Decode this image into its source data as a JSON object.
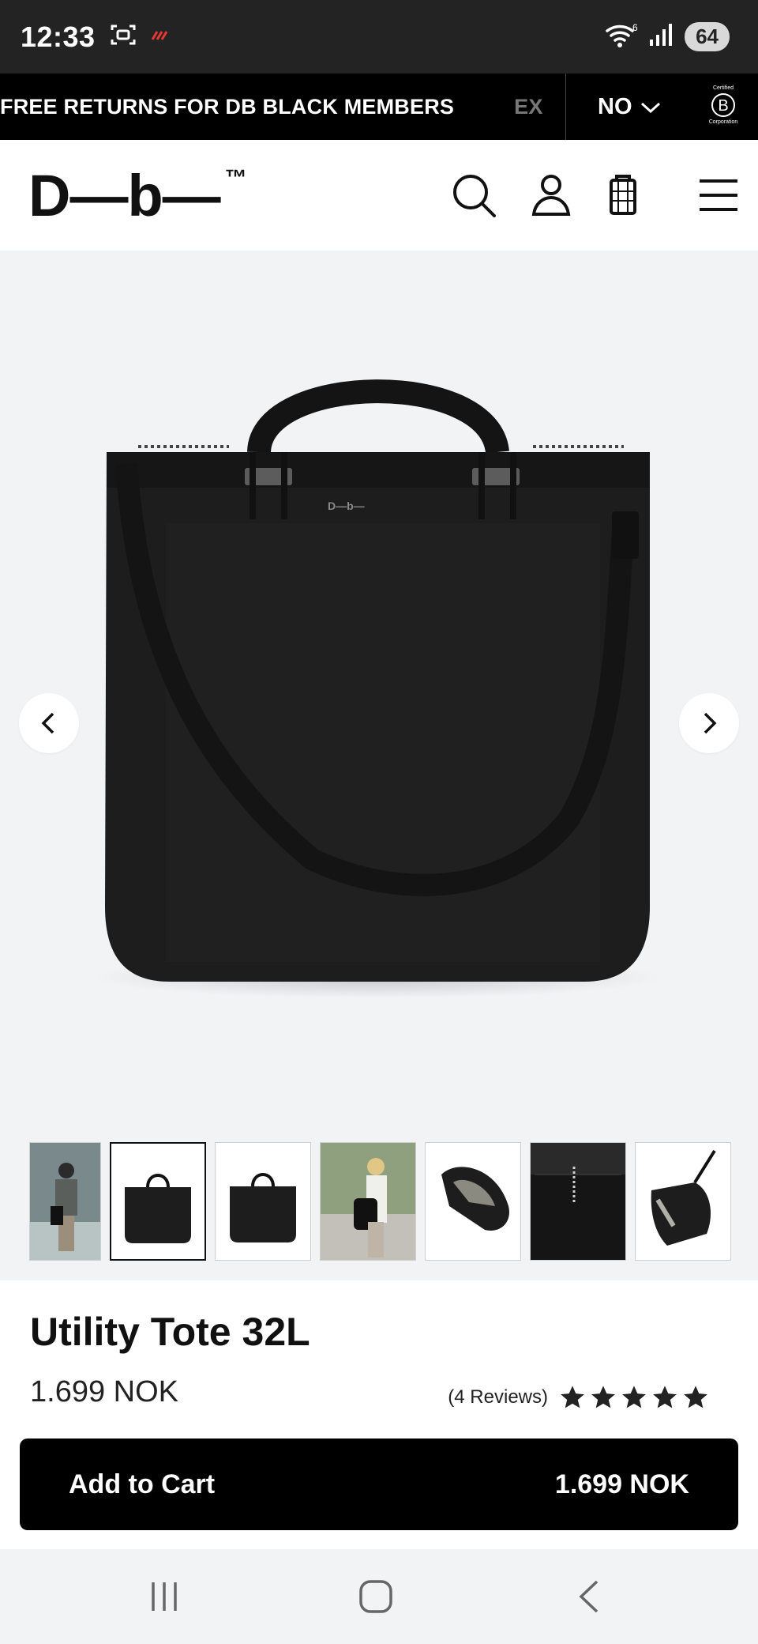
{
  "status_bar": {
    "time": "12:33",
    "battery": "64"
  },
  "promo": {
    "text": "FREE RETURNS FOR DB BLACK MEMBERS",
    "next_text": "EX",
    "country": "NO",
    "bcorp_top": "Certified",
    "bcorp_bottom": "Corporation"
  },
  "header": {
    "logo": "D—b—",
    "logo_tm": "™"
  },
  "product": {
    "title": "Utility Tote 32L",
    "price": "1.699 NOK",
    "reviews": "(4 Reviews)",
    "rating": 5,
    "bag_print": "D—b—"
  },
  "cart": {
    "label": "Add to Cart",
    "price": "1.699 NOK"
  },
  "colors": {
    "black": "#000000",
    "bg": "#f2f3f5",
    "statusbar": "#232323"
  }
}
